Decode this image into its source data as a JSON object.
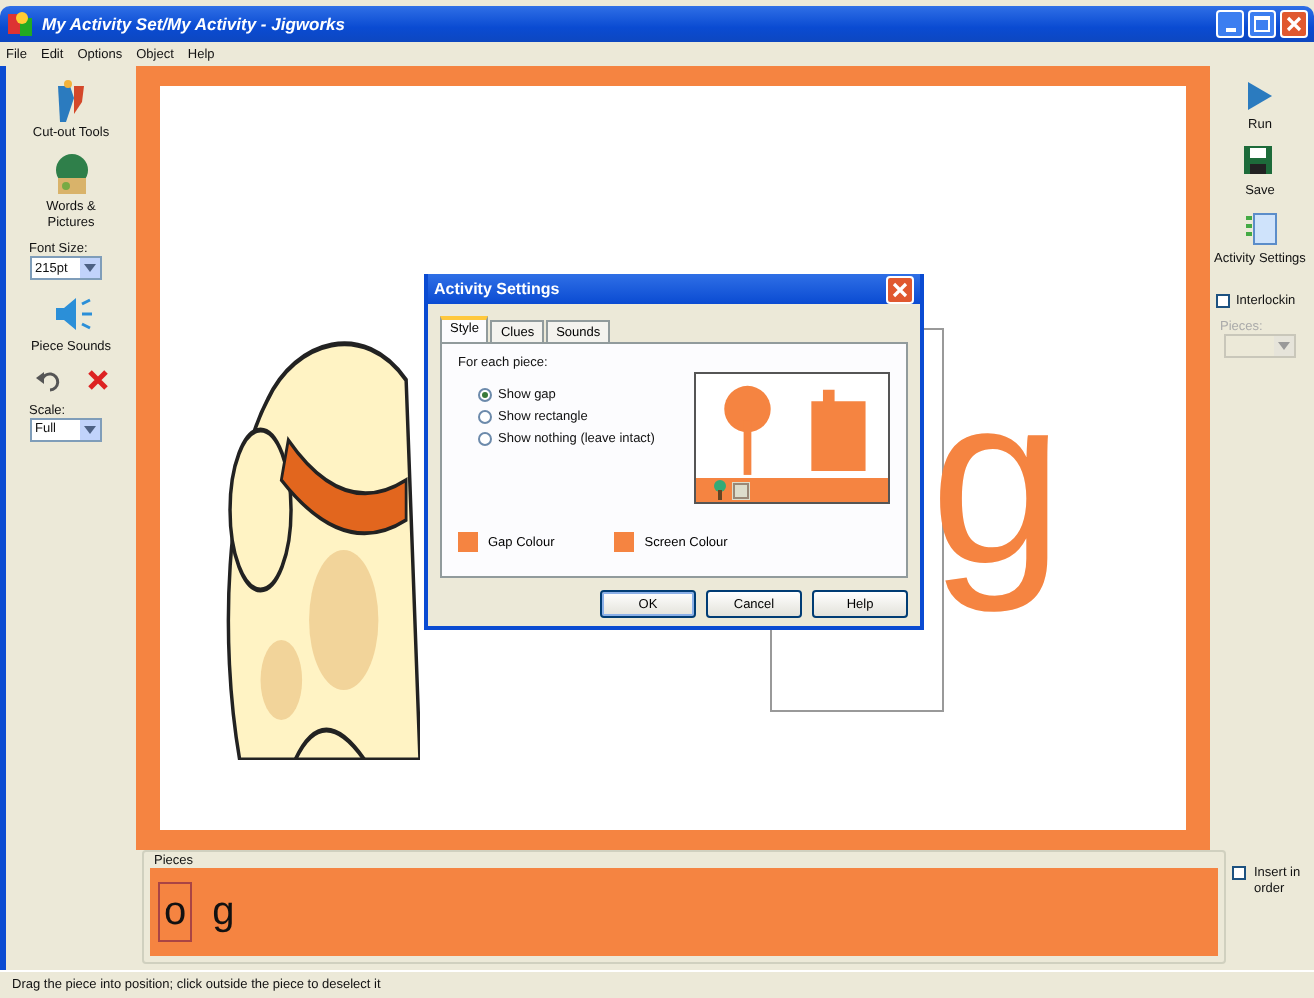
{
  "window": {
    "title": "My Activity Set/My Activity - Jigworks"
  },
  "menu": [
    "File",
    "Edit",
    "Options",
    "Object",
    "Help"
  ],
  "left_toolbar": [
    {
      "kind": "tool",
      "label": "Cut-out Tools"
    },
    {
      "kind": "tool",
      "label": "Words & Pictures"
    },
    {
      "kind": "dropdown",
      "label": "Font Size:",
      "value": "215pt"
    },
    {
      "kind": "tool",
      "label": "Piece Sounds"
    },
    {
      "kind": "icons"
    },
    {
      "kind": "dropdown",
      "label": "Scale:",
      "value": "Full"
    }
  ],
  "canvas": {
    "letter": "g"
  },
  "right_toolbar": [
    {
      "kind": "tool",
      "label": "Run"
    },
    {
      "kind": "tool",
      "label": "Save"
    },
    {
      "kind": "tool",
      "label": "Activity Settings"
    },
    {
      "kind": "checkbox",
      "label": "Interlockin",
      "checked": false
    },
    {
      "kind": "dropdown",
      "label": "Pieces:",
      "disabled": true
    }
  ],
  "dialog": {
    "title": "Activity Settings",
    "tabs": [
      {
        "label": "Style",
        "selected": true
      },
      {
        "label": "Clues",
        "selected": false
      },
      {
        "label": "Sounds",
        "selected": false
      }
    ],
    "heading": "For each piece:",
    "options": [
      {
        "label": "Show gap",
        "selected": true
      },
      {
        "label": "Show rectangle",
        "selected": false
      },
      {
        "label": "Show nothing (leave intact)",
        "selected": false
      }
    ],
    "colours": [
      {
        "label": "Gap Colour",
        "color": "#f58441"
      },
      {
        "label": "Screen Colour",
        "color": "#f58441"
      }
    ],
    "buttons": [
      "OK",
      "Cancel",
      "Help"
    ]
  },
  "pieces_panel": {
    "title": "Pieces",
    "pieces": [
      {
        "label": "o",
        "selected": true
      },
      {
        "label": "g",
        "selected": false
      }
    ],
    "insert_in_order": {
      "label": "Insert in order",
      "checked": false
    }
  },
  "status_bar": "Drag the piece into position; click outside the piece to deselect it"
}
